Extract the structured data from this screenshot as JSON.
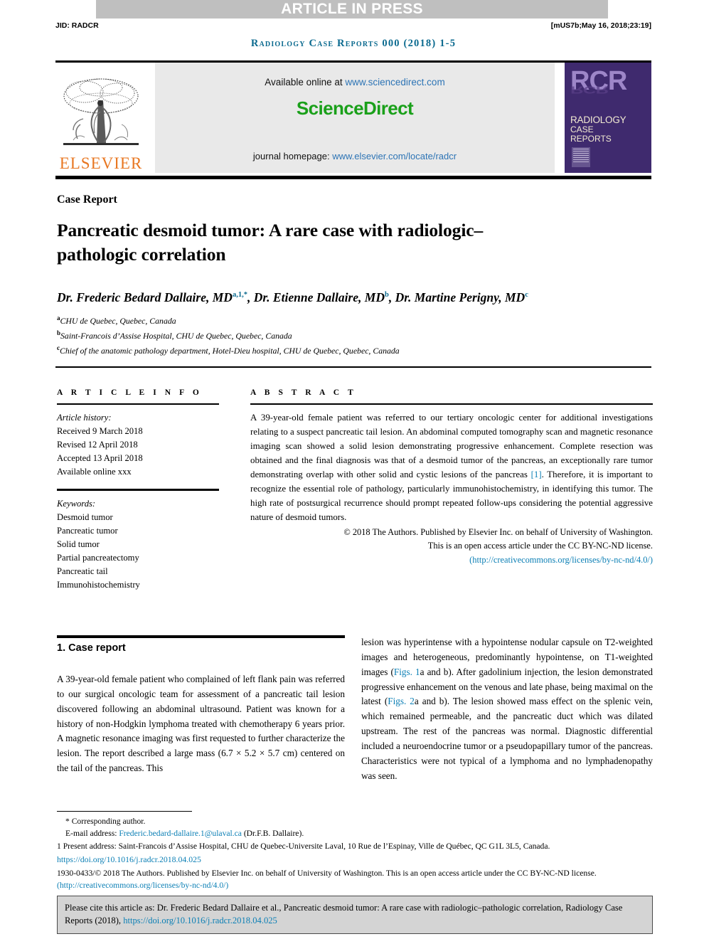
{
  "banner": {
    "article_in_press": "ARTICLE IN PRESS",
    "jid": "JID: RADCR",
    "stamp": "[mUS7b;May 16, 2018;23:19]",
    "masthead": "Radiology Case Reports 000 (2018) 1-5"
  },
  "sciencedirect": {
    "available_prefix": "Available online at ",
    "available_link": "www.sciencedirect.com",
    "wordmark_science": "Science",
    "wordmark_direct": "Direct",
    "homepage_prefix": "journal homepage: ",
    "homepage_link": "www.elsevier.com/locate/radcr",
    "elsevier_wordmark": "ELSEVIER"
  },
  "cover": {
    "rcr": "RCR",
    "line1": "RADIOLOGY",
    "line2": "CASE",
    "line3": "REPORTS"
  },
  "article": {
    "type_label": "Case Report",
    "title": "Pancreatic desmoid tumor: A rare case with radiologic–pathologic correlation",
    "authors_html": "Dr. Frederic Bedard Dallaire, MD<sup>a,1,*</sup>, Dr. Etienne Dallaire, MD<sup>b</sup>, Dr. Martine Perigny, MD<sup>c</sup>",
    "affiliations": [
      {
        "marker": "a",
        "text": "CHU de Quebec, Quebec, Canada"
      },
      {
        "marker": "b",
        "text": "Saint-Francois d’Assise Hospital, CHU de Quebec, Quebec, Canada"
      },
      {
        "marker": "c",
        "text": "Chief of the anatomic pathology department, Hotel-Dieu hospital, CHU de Quebec, Quebec, Canada"
      }
    ]
  },
  "article_info": {
    "heading": "A R T I C L E   I N F O",
    "history_label": "Article history:",
    "history": [
      "Received 9 March 2018",
      "Revised 12 April 2018",
      "Accepted 13 April 2018",
      "Available online xxx"
    ],
    "keywords_label": "Keywords:",
    "keywords": [
      "Desmoid tumor",
      "Pancreatic tumor",
      "Solid tumor",
      "Partial pancreatectomy",
      "Pancreatic tail",
      "Immunohistochemistry"
    ]
  },
  "abstract": {
    "heading": "A B S T R A C T",
    "part1": "A 39-year-old female patient was referred to our tertiary oncologic center for additional investigations relating to a suspect pancreatic tail lesion. An abdominal computed tomography scan and magnetic resonance imaging scan showed a solid lesion demonstrating progressive enhancement. Complete resection was obtained and the final diagnosis was that of a desmoid tumor of the pancreas, an exceptionally rare tumor demonstrating overlap with other solid and cystic lesions of the pancreas ",
    "ref_link": "[1]",
    "part2": ". Therefore, it is important to recognize the essential role of pathology, particularly immunohistochemistry, in identifying this tumor. The high rate of postsurgical recurrence should prompt repeated follow-ups considering the potential aggressive nature of desmoid tumors.",
    "copyright_line1": "© 2018 The Authors. Published by Elsevier Inc. on behalf of University of Washington.",
    "copyright_line2": "This is an open access article under the CC BY-NC-ND license.",
    "license_url": "(http://creativecommons.org/licenses/by-nc-nd/4.0/)"
  },
  "body": {
    "section_title": "1. Case report",
    "left_paragraph": "A 39-year-old female patient who complained of left flank pain was referred to our surgical oncologic team for assessment of a pancreatic tail lesion discovered following an abdominal ultrasound. Patient was known for a history of non-Hodgkin lymphoma treated with chemotherapy 6 years prior. A magnetic resonance imaging was first requested to further characterize the lesion. The report described a large mass (6.7 × 5.2 × 5.7 cm) centered on the tail of the pancreas. This",
    "right_part1": "lesion was hyperintense with a hypointense nodular capsule on T2-weighted images and heterogeneous, predominantly hypointense, on T1-weighted images (",
    "right_fig1": "Figs. 1",
    "right_part2": "a and b). After gadolinium injection, the lesion demonstrated progressive enhancement on the venous and late phase, being maximal on the latest (",
    "right_fig2": "Figs. 2",
    "right_part3": "a and b). The lesion showed mass effect on the splenic vein, which remained permeable, and the pancreatic duct which was dilated upstream. The rest of the pancreas was normal. Diagnostic differential included a neuroendocrine tumor or a pseudopapillary tumor of the pancreas. Characteristics were not typical of a lymphoma and no lymphadenopathy was seen."
  },
  "footnotes": {
    "corresponding": "* Corresponding author.",
    "email_label": "E-mail address: ",
    "email": "Frederic.bedard-dallaire.1@ulaval.ca",
    "email_suffix": " (Dr.F.B. Dallaire).",
    "present_address": "1 Present address: Saint-Francois d’Assise Hospital, CHU de Quebec-Universite Laval, 10 Rue de l’Espinay, Ville de Québec, QC G1L 3L5, Canada.",
    "doi": "https://doi.org/10.1016/j.radcr.2018.04.025",
    "copyright_part1": "1930-0433/© 2018 The Authors. Published by Elsevier Inc. on behalf of University of Washington. This is an open access article under the CC BY-NC-ND license. ",
    "copyright_license_url": "(http://creativecommons.org/licenses/by-nc-nd/4.0/)"
  },
  "cite_box": {
    "text": "Please cite this article as: Dr. Frederic Bedard Dallaire et al., Pancreatic desmoid tumor: A rare case with radiologic–pathologic correlation, Radiology Case Reports (2018), ",
    "link": "https://doi.org/10.1016/j.radcr.2018.04.025"
  },
  "colors": {
    "masthead_teal": "#0b6a8f",
    "link_blue": "#0b7fb5",
    "elsevier_orange": "#e87722",
    "sciencedirect_green": "#1aa01a",
    "cover_purple": "#3f2a6e",
    "band_gray": "#bfbfbf"
  }
}
